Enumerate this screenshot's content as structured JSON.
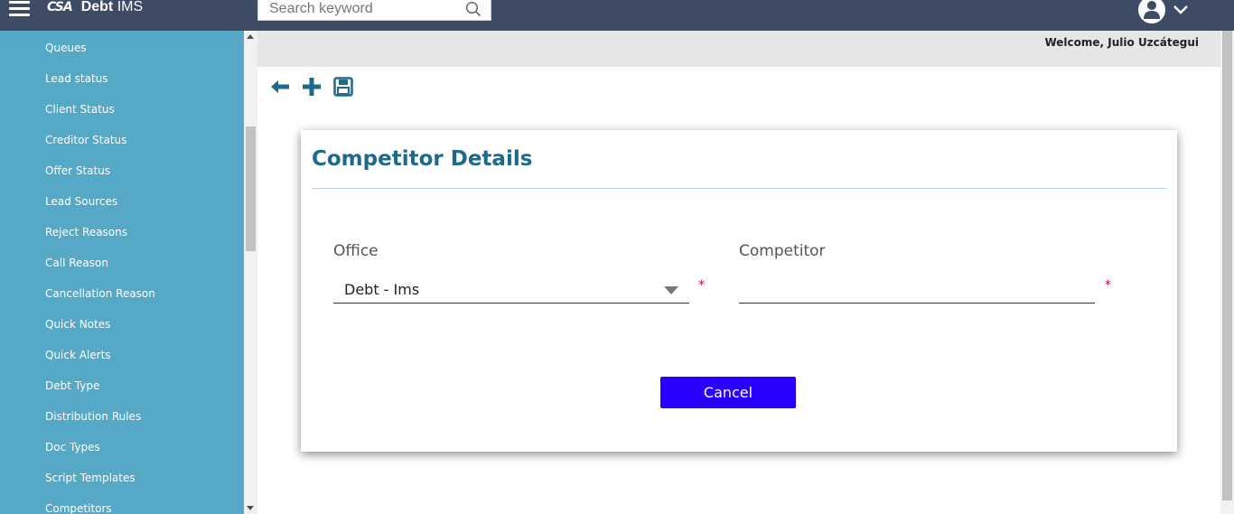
{
  "header": {
    "logo_mark": "CSA",
    "app_name_bold": "Debt",
    "app_name_rest": " IMS",
    "search_placeholder": "Search keyword"
  },
  "sidebar": {
    "items": [
      {
        "label": "Queues"
      },
      {
        "label": "Lead status"
      },
      {
        "label": "Client Status"
      },
      {
        "label": "Creditor Status"
      },
      {
        "label": "Offer Status"
      },
      {
        "label": "Lead Sources"
      },
      {
        "label": "Reject Reasons"
      },
      {
        "label": "Call Reason"
      },
      {
        "label": "Cancellation Reason"
      },
      {
        "label": "Quick Notes"
      },
      {
        "label": "Quick Alerts"
      },
      {
        "label": "Debt Type"
      },
      {
        "label": "Distribution Rules"
      },
      {
        "label": "Doc Types"
      },
      {
        "label": "Script Templates"
      },
      {
        "label": "Competitors"
      }
    ]
  },
  "welcome": "Welcome, Julio Uzcátegui",
  "form": {
    "title": "Competitor Details",
    "office_label": "Office",
    "office_value": "Debt - Ims",
    "competitor_label": "Competitor",
    "competitor_value": "",
    "required_marker": "*",
    "cancel_label": "Cancel"
  },
  "colors": {
    "topbar": "#3e4b64",
    "sidebar": "#55a8c6",
    "title": "#1e6a8d",
    "cancel_button": "#2900ff",
    "required": "#d9002f"
  }
}
